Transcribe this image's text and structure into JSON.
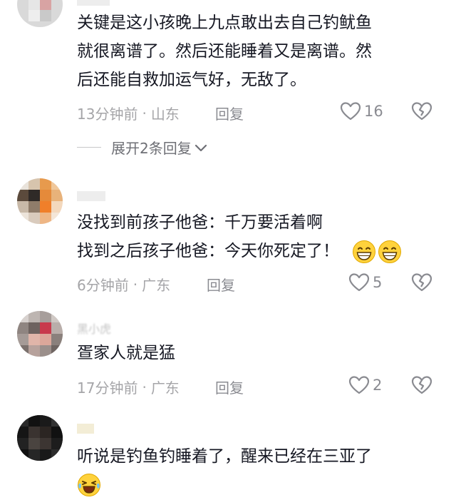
{
  "comments": [
    {
      "text_lines": [
        "关键是这小孩晚上九点敢出去自己钓鱿鱼",
        "就很离谱了。然后还能睡着又是离谱。然",
        "后还能自救加运气好，无敌了。"
      ],
      "time": "13分钟前",
      "location": "山东",
      "reply_label": "回复",
      "likes": "16",
      "expand_label": "展开2条回复"
    },
    {
      "text_lines": [
        "没找到前孩子他爸：千万要活着啊",
        "找到之后孩子他爸：今天你死定了！"
      ],
      "emoji": [
        "grin-icon",
        "grin-icon"
      ],
      "time": "6分钟前",
      "location": "广东",
      "reply_label": "回复",
      "likes": "5"
    },
    {
      "username": "黑小虎",
      "text_lines": [
        "疍家人就是猛"
      ],
      "time": "17分钟前",
      "location": "广东",
      "reply_label": "回复",
      "likes": "2"
    },
    {
      "text_lines": [
        "听说是钓鱼钓睡着了，醒来已经在三亚了"
      ],
      "emoji": [
        "laugh-cry-icon"
      ]
    }
  ],
  "separator": "·",
  "colors": {
    "text": "#161823",
    "meta": "#a5a5a8",
    "icon": "#8a8b91"
  }
}
